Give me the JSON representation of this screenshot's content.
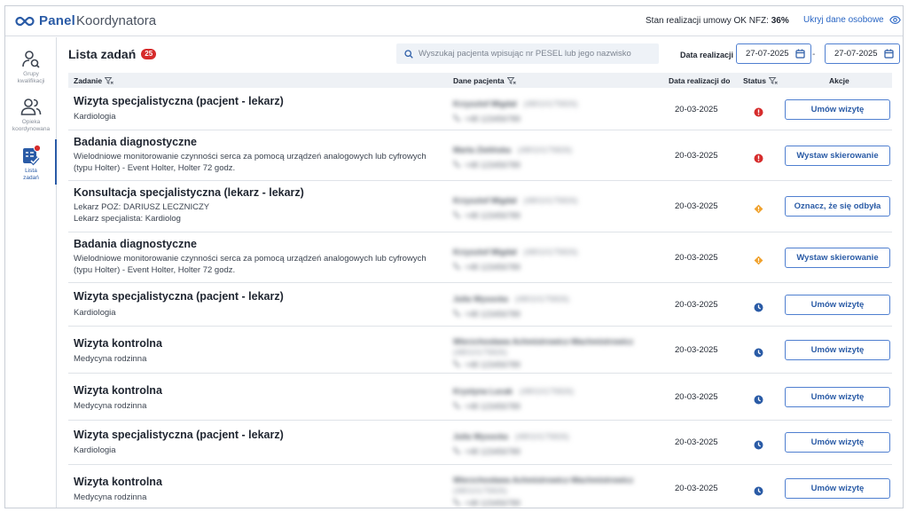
{
  "header": {
    "logo_bold": "Panel",
    "logo_light": "Koordynatora",
    "nfz_label": "Stan realizacji umowy OK NFZ:",
    "nfz_value": "36%",
    "hide_data_label": "Ukryj dane osobowe"
  },
  "sidebar": {
    "items": [
      {
        "label_line1": "Grupy",
        "label_line2": "kwalifikacji",
        "icon": "user-search-icon"
      },
      {
        "label_line1": "Opieka",
        "label_line2": "koordynowana",
        "icon": "users-icon"
      },
      {
        "label_line1": "Lista",
        "label_line2": "zadań",
        "icon": "task-list-icon"
      }
    ]
  },
  "main": {
    "title": "Lista zadań",
    "count": "25",
    "search_placeholder": "Wyszukaj pacjenta wpisując nr PESEL lub jego nazwisko",
    "date_label": "Data realizacji",
    "date_from": "27-07-2025",
    "date_sep": "-",
    "date_to": "27-07-2025"
  },
  "table": {
    "headers": {
      "task": "Zadanie",
      "patient": "Dane pacjenta",
      "date": "Data realizacji do",
      "status": "Status",
      "actions": "Akcje"
    },
    "rows": [
      {
        "title": "Wizyta specjalistyczna (pacjent - lekarz)",
        "sub1": "Kardiologia",
        "sub2": "",
        "patient_name": "Krzysztof Migdał",
        "pesel": "(48010175826)",
        "phone": "+48 123456789",
        "date": "20-03-2025",
        "status": "error",
        "action": "Umów wizytę"
      },
      {
        "title": "Badania diagnostyczne",
        "sub1": "Wielodniowe monitorowanie czynności serca za pomocą urządzeń analogowych lub cyfrowych",
        "sub2": "(typu Holter) - Event Holter, Holter 72 godz.",
        "patient_name": "Marta Zielińska",
        "pesel": "(48010175826)",
        "phone": "+48 123456789",
        "date": "20-03-2025",
        "status": "error",
        "action": "Wystaw skierowanie"
      },
      {
        "title": "Konsultacja specjalistyczna (lekarz - lekarz)",
        "sub1": "Lekarz POZ: DARIUSZ LECZNICZY",
        "sub2": "Lekarz specjalista: Kardiolog",
        "patient_name": "Krzysztof Migdał",
        "pesel": "(48010175826)",
        "phone": "+48 123456789",
        "date": "20-03-2025",
        "status": "warning",
        "action": "Oznacz, że się odbyła"
      },
      {
        "title": "Badania diagnostyczne",
        "sub1": "Wielodniowe monitorowanie czynności serca za pomocą urządzeń analogowych lub cyfrowych",
        "sub2": "(typu Holter) - Event Holter, Holter 72 godz.",
        "patient_name": "Krzysztof Migdał",
        "pesel": "(48010175826)",
        "phone": "+48 123456789",
        "date": "20-03-2025",
        "status": "warning",
        "action": "Wystaw skierowanie"
      },
      {
        "title": "Wizyta specjalistyczna (pacjent - lekarz)",
        "sub1": "Kardiologia",
        "sub2": "",
        "patient_name": "Julia Wysocka",
        "pesel": "(48010175826)",
        "phone": "+48 123456789",
        "date": "20-03-2025",
        "status": "pending",
        "action": "Umów wizytę"
      },
      {
        "title": "Wizyta kontrolna",
        "sub1": "Medycyna rodzinna",
        "sub2": "",
        "patient_name": "Wierzchosława Achmistrowicz-Wachmistrowicz",
        "pesel": "(48010175826)",
        "phone": "+48 123456789",
        "date": "20-03-2025",
        "status": "pending",
        "action": "Umów wizytę"
      },
      {
        "title": "Wizyta kontrolna",
        "sub1": "Medycyna rodzinna",
        "sub2": "",
        "patient_name": "Krystyna Lucak",
        "pesel": "(48010175826)",
        "phone": "+48 123456789",
        "date": "20-03-2025",
        "status": "pending",
        "action": "Umów wizytę"
      },
      {
        "title": "Wizyta specjalistyczna (pacjent - lekarz)",
        "sub1": "Kardiologia",
        "sub2": "",
        "patient_name": "Julia Wysocka",
        "pesel": "(48010175826)",
        "phone": "+48 123456789",
        "date": "20-03-2025",
        "status": "pending",
        "action": "Umów wizytę"
      },
      {
        "title": "Wizyta kontrolna",
        "sub1": "Medycyna rodzinna",
        "sub2": "",
        "patient_name": "Wierzchosława Achmistrowicz-Wachmistrowicz",
        "pesel": "(48010175826)",
        "phone": "+48 123456789",
        "date": "20-03-2025",
        "status": "pending",
        "action": "Umów wizytę"
      }
    ]
  },
  "colors": {
    "brand": "#2a5ba6",
    "error": "#d62c2c",
    "warning": "#f0a22e",
    "pending": "#2a5ba6"
  }
}
